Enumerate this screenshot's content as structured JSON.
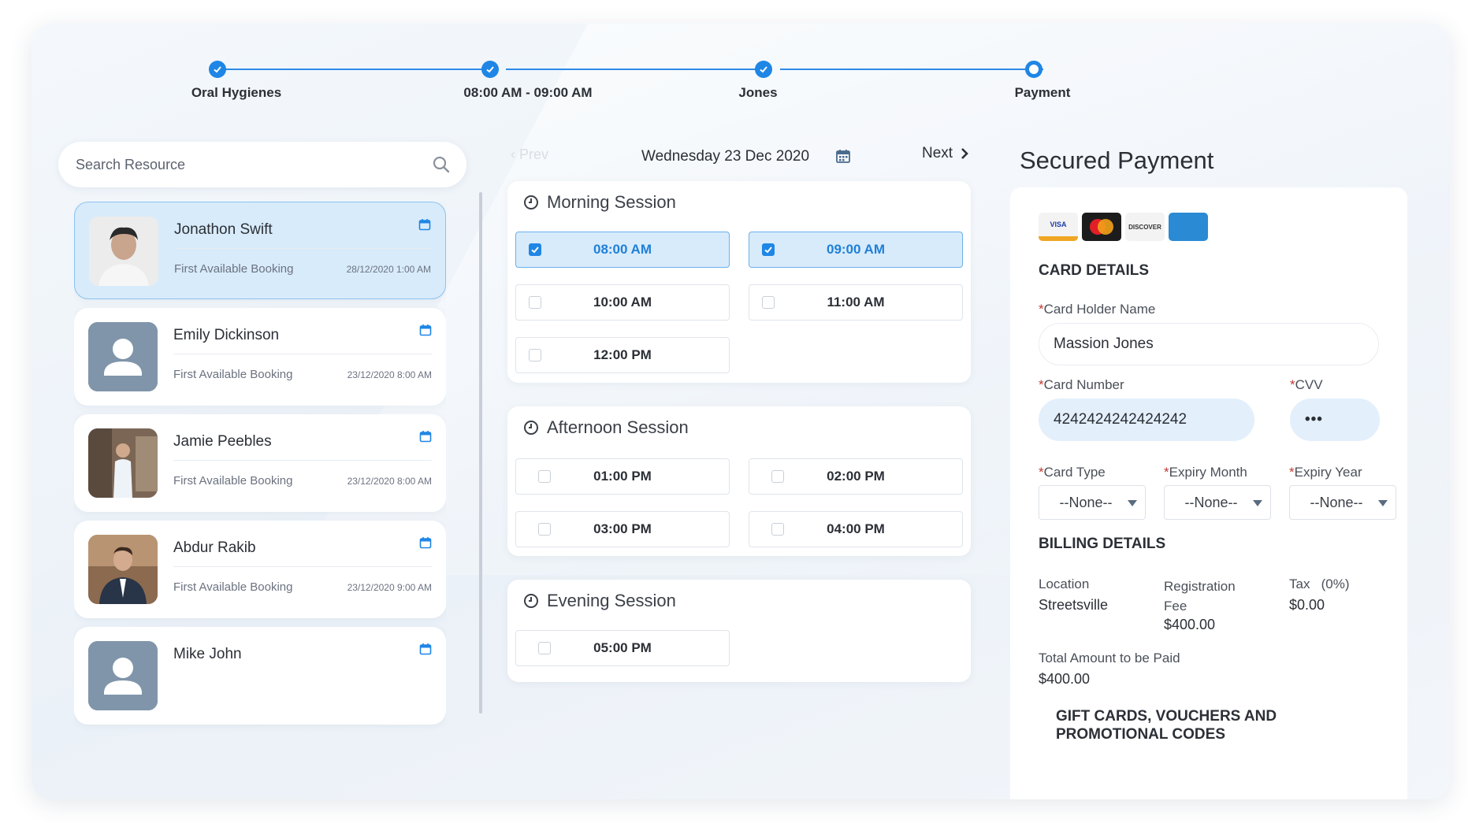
{
  "stepper": {
    "steps": [
      {
        "label": "Oral Hygienes",
        "state": "done"
      },
      {
        "label": "08:00 AM -  09:00 AM",
        "state": "done"
      },
      {
        "label": "Jones",
        "state": "done"
      },
      {
        "label": "Payment",
        "state": "current"
      }
    ]
  },
  "search": {
    "placeholder": "Search Resource",
    "icon": "search-icon"
  },
  "resources": [
    {
      "name": "Jonathon Swift",
      "sub": "First Available Booking",
      "date": "28/12/2020 1:00 AM",
      "selected": true
    },
    {
      "name": "Emily Dickinson",
      "sub": "First Available Booking",
      "date": "23/12/2020 8:00 AM",
      "selected": false
    },
    {
      "name": "Jamie Peebles",
      "sub": "First Available Booking",
      "date": "23/12/2020 8:00 AM",
      "selected": false
    },
    {
      "name": "Abdur Rakib",
      "sub": "First Available Booking",
      "date": "23/12/2020 9:00 AM",
      "selected": false
    },
    {
      "name": "Mike John",
      "sub": "",
      "date": "",
      "selected": false
    }
  ],
  "schedule": {
    "prev_label": "Prev",
    "date_label": "Wednesday 23 Dec 2020",
    "next_label": "Next",
    "sessions": [
      {
        "title": "Morning Session",
        "slots": [
          {
            "time": "08:00 AM",
            "checked": true
          },
          {
            "time": "09:00 AM",
            "checked": true
          },
          {
            "time": "10:00 AM",
            "checked": false
          },
          {
            "time": "11:00 AM",
            "checked": false
          },
          {
            "time": "12:00 PM",
            "checked": false
          }
        ]
      },
      {
        "title": "Afternoon Session",
        "slots": [
          {
            "time": "01:00 PM",
            "checked": false
          },
          {
            "time": "02:00 PM",
            "checked": false
          },
          {
            "time": "03:00 PM",
            "checked": false
          },
          {
            "time": "04:00 PM",
            "checked": false
          }
        ]
      },
      {
        "title": "Evening Session",
        "slots": [
          {
            "time": "05:00 PM",
            "checked": false
          }
        ]
      }
    ]
  },
  "payment": {
    "title": "Secured Payment",
    "card_logos": [
      "VISA",
      "MasterCard",
      "DISCOVER",
      "AMERICAN EXPRESS"
    ],
    "card_details_heading": "CARD DETAILS",
    "holder_label": "Card Holder Name",
    "holder_value": "Massion Jones",
    "number_label": "Card Number",
    "number_value": "4242424242424242",
    "cvv_label": "CVV",
    "cvv_value": "•••",
    "card_type_label": "Card Type",
    "card_type_value": "--None--",
    "expiry_month_label": "Expiry Month",
    "expiry_month_value": "--None--",
    "expiry_year_label": "Expiry Year",
    "expiry_year_value": "--None--",
    "required_mark": "*",
    "billing_heading": "BILLING DETAILS",
    "location_label": "Location",
    "location_value": "Streetsville",
    "fee_label": "Registration Fee",
    "fee_value": "$400.00",
    "tax_label": "Tax   (0%)",
    "tax_value": "$0.00",
    "total_label": "Total Amount to be Paid",
    "total_value": "$400.00",
    "gift_heading": "GIFT CARDS, VOUCHERS AND PROMOTIONAL CODES"
  },
  "colors": {
    "accent": "#1f86e5",
    "selected_bg": "#d8ebfa"
  }
}
